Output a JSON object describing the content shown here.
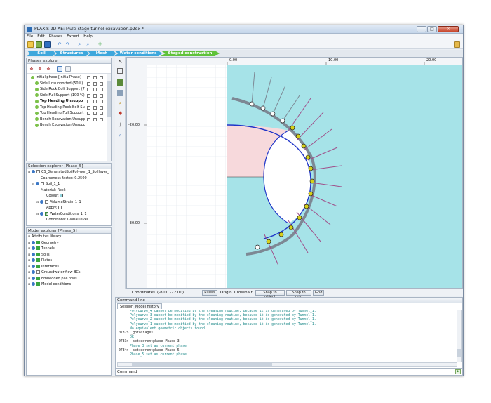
{
  "window": {
    "title": "PLAXIS 2D AE: Multi-stage tunnel excavation.p2dx *",
    "minimize": "–",
    "maximize": "□",
    "close": "✕"
  },
  "menu": [
    "File",
    "Edit",
    "Phases",
    "Expert",
    "Help"
  ],
  "modes": [
    {
      "label": "Soil",
      "color": "blue"
    },
    {
      "label": "Structures",
      "color": "blue"
    },
    {
      "label": "Mesh",
      "color": "blue"
    },
    {
      "label": "Water conditions",
      "color": "blue"
    },
    {
      "label": "Staged construction",
      "color": "green"
    }
  ],
  "phases_explorer": {
    "title": "Phases explorer",
    "phases": [
      {
        "label": "Initial phase [InitialPhase]",
        "bold": false
      },
      {
        "label": "Side Unsupported (50%)",
        "bold": false
      },
      {
        "label": "Side Rock Bolt Support (7",
        "bold": false
      },
      {
        "label": "Side Full Support (100 %)",
        "bold": false
      },
      {
        "label": "Top Heading Unsuppo",
        "bold": true
      },
      {
        "label": "Top Heading Rock Bolt Su",
        "bold": false
      },
      {
        "label": "Top Heading Full Support",
        "bold": false
      },
      {
        "label": "Bench Excavation Unsupp",
        "bold": false
      },
      {
        "label": "Bench Excavation Unsupp",
        "bold": false
      }
    ]
  },
  "selection_explorer": {
    "title": "Selection explorer [Phase_5]",
    "items": [
      {
        "label": "CS_GeneratedSoilPolygon_1_Soillayer_",
        "indent": 0
      },
      {
        "label": "Coarseness factor: 0.2500",
        "indent": 2
      },
      {
        "label": "Soil_1_1",
        "indent": 1
      },
      {
        "label": "Material: Rock",
        "indent": 2
      },
      {
        "label": "Colour:",
        "indent": 3
      },
      {
        "label": "VolumeStrain_1_1",
        "indent": 2
      },
      {
        "label": "Apply:",
        "indent": 3
      },
      {
        "label": "WaterConditions_1_1",
        "indent": 2
      },
      {
        "label": "Conditions: Global level",
        "indent": 3
      }
    ]
  },
  "model_explorer": {
    "title": "Model explorer [Phase_5]",
    "items": [
      "Attributes library",
      "Geometry",
      "Tunnels",
      "Soils",
      "Plates",
      "Interfaces",
      "Groundwater flow BCs",
      "Embedded pile rows",
      "Model conditions"
    ]
  },
  "canvas": {
    "x_ticks": [
      "0.00",
      "10.00",
      "20.00"
    ],
    "y_ticks": [
      "-20.00",
      "-30.00"
    ],
    "colors": {
      "soil": "#a6e3e8",
      "excavated": "#f7d9dc",
      "lining": "#1f34c8",
      "bolt": "#a0508a",
      "plate": "#7d8894",
      "node": "#d6d01a"
    }
  },
  "statusbar": {
    "coordinates_label": "Coordinates",
    "coordinates_value": "(-8.00 -22.00)",
    "rulers": "Rulers",
    "origin": "Origin",
    "crosshair": "Crosshair",
    "snap_object": "Snap to object",
    "snap_grid": "Snap to grid",
    "grid": "Grid"
  },
  "command_line": {
    "title": "Command line",
    "tabs": [
      "Session",
      "Model history"
    ],
    "log": [
      {
        "text": "Polycurve_4 cannot be modified by the cleaning routine, because it is generated by Tunnel_1.",
        "style": "g"
      },
      {
        "text": "Polycurve_3 cannot be modified by the cleaning routine, because it is generated by Tunnel_1.",
        "style": "g"
      },
      {
        "text": "Polycurve_2 cannot be modified by the cleaning routine, because it is generated by Tunnel_1.",
        "style": "g"
      },
      {
        "text": "Polycurve_1 cannot be modified by the cleaning routine, because it is generated by Tunnel_1.",
        "style": "g"
      },
      {
        "text": "No equivalent geometric objects found",
        "style": "g"
      },
      {
        "text": "0732> _gotostages",
        "style": "k"
      },
      {
        "text": "OK",
        "style": "g"
      },
      {
        "text": "0733> _setcurrentphase Phase_3",
        "style": "k"
      },
      {
        "text": "Phase_3 set as current phase",
        "style": "g"
      },
      {
        "text": "0734> _setcurrentphase Phase_5",
        "style": "k"
      },
      {
        "text": "Phase_5 set as current phase",
        "style": "g"
      }
    ],
    "input_label": "Command"
  }
}
